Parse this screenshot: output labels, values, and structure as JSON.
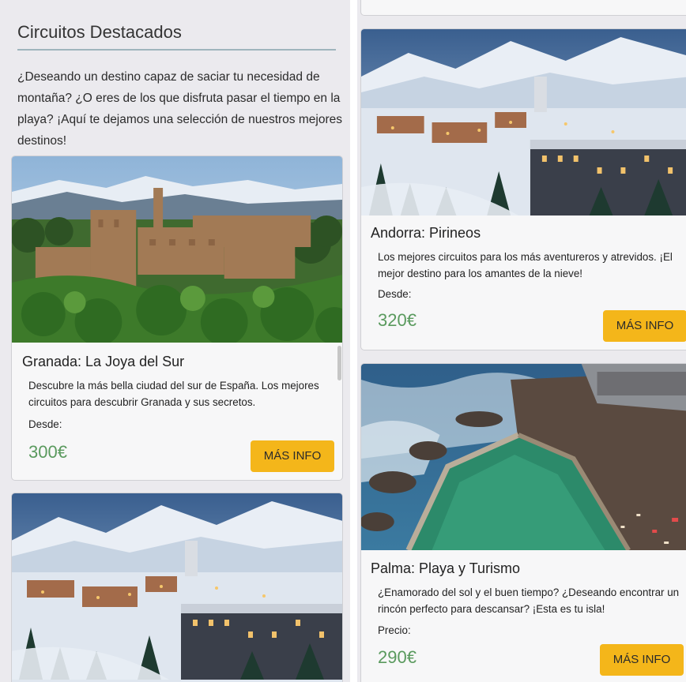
{
  "section": {
    "title": "Circuitos Destacados",
    "intro": "¿Deseando un destino capaz de saciar tu necesidad de montaña? ¿O eres de los que disfruta pasar el tiempo en la playa? ¡Aquí te dejamos una selección de nuestros mejores destinos!"
  },
  "cards": {
    "granada": {
      "title": "Granada: La Joya del Sur",
      "description": "Descubre la más bella ciudad del sur de España. Los mejores circuitos para descubrir Granada y sus secretos.",
      "price_label": "Desde:",
      "price": "300€",
      "button": "MÁS INFO"
    },
    "andorra": {
      "title": "Andorra: Pirineos",
      "description": "Los mejores circuitos para los más aventureros y atrevidos. ¡El mejor destino para los amantes de la nieve!",
      "price_label": "Desde:",
      "price": "320€",
      "button": "MÁS INFO"
    },
    "palma": {
      "title": "Palma: Playa y Turismo",
      "description": "¿Enamorado del sol y el buen tiempo? ¿Deseando encontrar un rincón perfecto para descansar? ¡Esta es tu isla!",
      "price_label": "Precio:",
      "price": "290€",
      "button": "MÁS INFO"
    }
  },
  "colors": {
    "accent_button": "#f4b61a",
    "price_green": "#5a9a5e",
    "panel_bg": "#ebeaee"
  }
}
